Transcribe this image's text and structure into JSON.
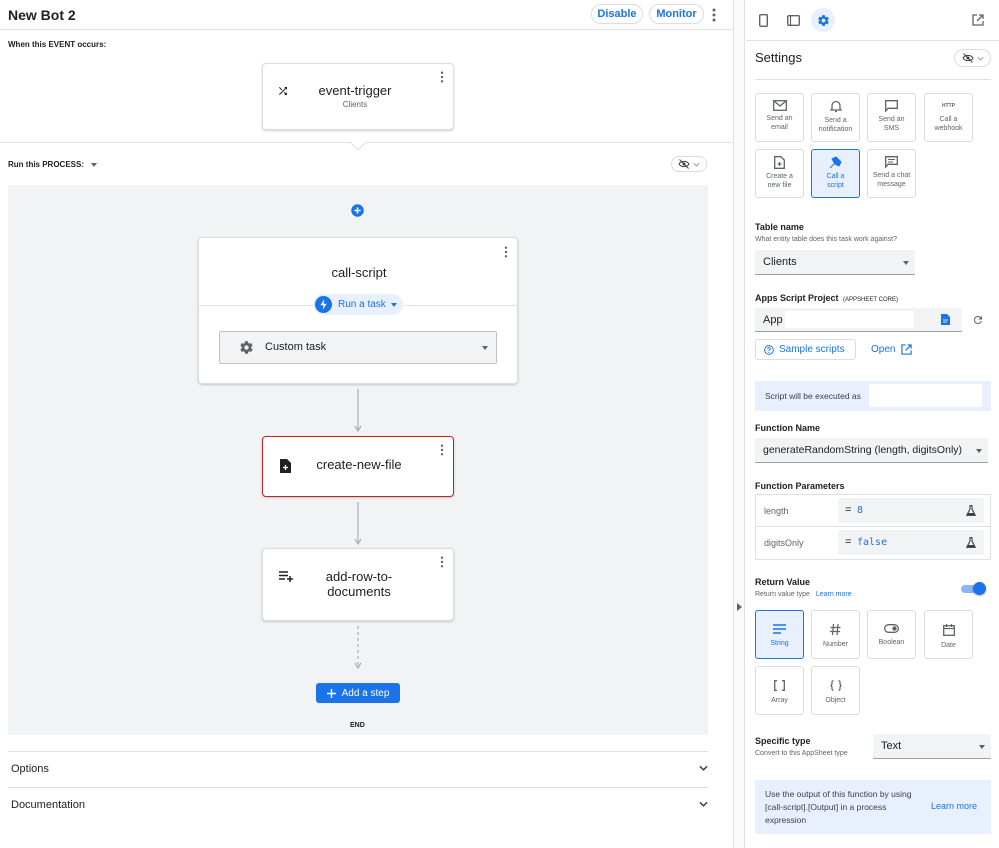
{
  "header": {
    "title": "New Bot 2",
    "disable_label": "Disable",
    "monitor_label": "Monitor"
  },
  "event_section": {
    "label": "When this EVENT occurs:",
    "card_title": "event-trigger",
    "card_subtitle": "Clients"
  },
  "process_section": {
    "label": "Run this PROCESS:"
  },
  "steps": {
    "call_script": {
      "title": "call-script",
      "run_task_label": "Run a task",
      "task_select_value": "Custom task"
    },
    "create_file": {
      "title": "create-new-file"
    },
    "add_row": {
      "title_line1": "add-row-to-",
      "title_line2": "documents"
    },
    "add_step_label": "Add a step",
    "end_label": "END"
  },
  "accordions": {
    "options": "Options",
    "documentation": "Documentation"
  },
  "settings": {
    "title": "Settings",
    "task_types": [
      {
        "line1": "Send an",
        "line2": "email",
        "icon": "email-icon"
      },
      {
        "line1": "Send a",
        "line2": "notification",
        "icon": "bell-icon"
      },
      {
        "line1": "Send an",
        "line2": "SMS",
        "icon": "sms-icon"
      },
      {
        "line1": "Call a",
        "line2": "webhook",
        "icon": "http-icon",
        "icon_text": "HTTP"
      },
      {
        "line1": "Create a",
        "line2": "new file",
        "icon": "new-file-icon"
      },
      {
        "line1": "Call a",
        "line2": "script",
        "icon": "script-icon"
      },
      {
        "line1": "Send a chat",
        "line2": "message",
        "icon": "chat-icon"
      }
    ],
    "table_name": {
      "label": "Table name",
      "help": "What entity table does this task work against?",
      "value": "Clients"
    },
    "apps_script": {
      "label": "Apps Script Project",
      "label_suffix": "(APPSHEET CORE)",
      "value": "App",
      "sample_scripts_label": "Sample scripts",
      "open_label": "Open"
    },
    "executed_as_label": "Script will be executed as",
    "function_name": {
      "label": "Function Name",
      "value": "generateRandomString (length, digitsOnly)"
    },
    "function_params": {
      "label": "Function Parameters",
      "params": [
        {
          "name": "length",
          "eq": "=",
          "value": "8"
        },
        {
          "name": "digitsOnly",
          "eq": "=",
          "value": "false"
        }
      ]
    },
    "return_value": {
      "label": "Return Value",
      "help": "Return value type",
      "learn_more": "Learn more",
      "enabled": true,
      "types": [
        "String",
        "Number",
        "Boolean",
        "Date",
        "Array",
        "Object"
      ],
      "selected_type": "String"
    },
    "specific_type": {
      "label": "Specific type",
      "help": "Convert to this AppSheet type",
      "value": "Text"
    },
    "info": {
      "line1": "Use the output of this function by using",
      "line2": "[call-script].[Output] in a process",
      "line3": "expression",
      "learn_more": "Learn more"
    }
  },
  "colors": {
    "accent": "#1a73e8",
    "accent_light": "#e8f0fe",
    "error_border": "#c5221f",
    "canvas_bg": "#f1f3f4"
  }
}
